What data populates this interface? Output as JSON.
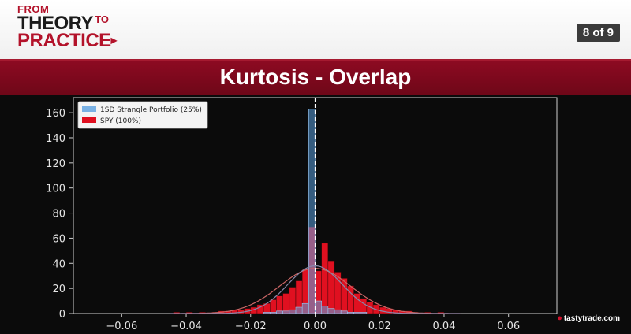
{
  "header": {
    "logo_from": "FROM",
    "logo_theory": "THEORY",
    "logo_to": "TO",
    "logo_practice": "PRACTICE",
    "page_count": "8 of 9"
  },
  "slide": {
    "title": "Kurtosis - Overlap"
  },
  "brand": {
    "name": "tastytrade",
    "suffix": ".com"
  },
  "colors": {
    "blue_series": "#5aa0e0",
    "red_series": "#e01020",
    "overlap": "#8a6ab8",
    "accent": "#8d0a22"
  },
  "chart_data": {
    "type": "bar",
    "title": "",
    "xlabel": "",
    "ylabel": "",
    "xlim": [
      -0.075,
      0.075
    ],
    "ylim": [
      0,
      172
    ],
    "xticks": [
      -0.06,
      -0.04,
      -0.02,
      0.0,
      0.02,
      0.04,
      0.06
    ],
    "xtick_labels": [
      "−0.06",
      "−0.04",
      "−0.02",
      "0.00",
      "0.02",
      "0.04",
      "0.06"
    ],
    "yticks": [
      0,
      20,
      40,
      60,
      80,
      100,
      120,
      140,
      160
    ],
    "ytick_labels": [
      "0",
      "20",
      "40",
      "60",
      "80",
      "100",
      "120",
      "140",
      "160"
    ],
    "legend_position": "top-left",
    "grid": false,
    "mean_line_x": 0.0,
    "bin_width": 0.002,
    "series": [
      {
        "name": "1SD Strangle Portfolio (25%)",
        "color": "#5aa0e0",
        "bin_lefts": [
          -0.016,
          -0.014,
          -0.012,
          -0.01,
          -0.008,
          -0.006,
          -0.004,
          -0.002,
          0.0,
          0.002,
          0.004,
          0.006,
          0.008,
          0.01,
          0.012,
          0.014
        ],
        "values": [
          1,
          1,
          2,
          2,
          3,
          5,
          8,
          163,
          10,
          6,
          4,
          3,
          2,
          1,
          1,
          1
        ]
      },
      {
        "name": "SPY (100%)",
        "color": "#e01020",
        "bin_lefts": [
          -0.044,
          -0.04,
          -0.036,
          -0.032,
          -0.03,
          -0.028,
          -0.026,
          -0.024,
          -0.022,
          -0.02,
          -0.018,
          -0.016,
          -0.014,
          -0.012,
          -0.01,
          -0.008,
          -0.006,
          -0.004,
          -0.002,
          0.0,
          0.002,
          0.004,
          0.006,
          0.008,
          0.01,
          0.012,
          0.014,
          0.016,
          0.018,
          0.02,
          0.022,
          0.024,
          0.026,
          0.028,
          0.03,
          0.034,
          0.038
        ],
        "values": [
          1,
          1,
          1,
          1,
          2,
          2,
          3,
          3,
          4,
          5,
          7,
          8,
          11,
          14,
          16,
          21,
          26,
          35,
          69,
          34,
          56,
          42,
          33,
          28,
          22,
          16,
          12,
          9,
          7,
          5,
          4,
          3,
          2,
          2,
          1,
          1,
          1
        ]
      }
    ],
    "density_curves": [
      {
        "name": "normal fit SPY",
        "color": "#cc6666",
        "mean": 0.0,
        "std": 0.011,
        "peak": 36
      },
      {
        "name": "normal fit strangle",
        "color": "#8888aa",
        "mean": 0.0,
        "std": 0.0085,
        "peak": 38
      }
    ]
  }
}
